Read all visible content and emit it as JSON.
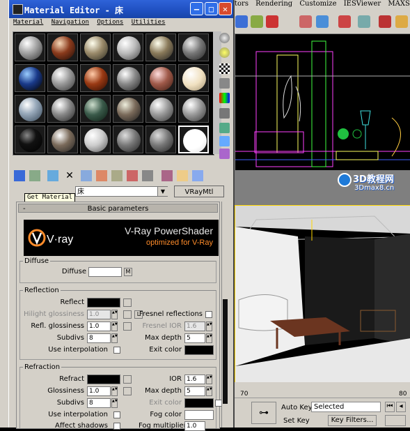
{
  "background_app": {
    "menu_items": [
      "tors",
      "Rendering",
      "Customize",
      "IESViewer",
      "MAXScript"
    ],
    "watermark": {
      "line1": "3D教程网",
      "line2": "3Dmax8.cn"
    },
    "timeline_tick": "70",
    "timeline_tick2": "80",
    "auto_key_label": "Auto Key",
    "set_key_label": "Set Key",
    "selected_value": "Selected",
    "key_filters_label": "Key Filters...",
    "colors": {
      "viewport_bg": "#000000",
      "highlight_border": "#ffd700"
    }
  },
  "material_editor": {
    "title": "Material Editor - 床",
    "menu": [
      "Material",
      "Navigation",
      "Options",
      "Utilities"
    ],
    "tooltip": "Get Material",
    "material_name": "床",
    "material_type": "VRayMtl",
    "rollout_title": "Basic parameters",
    "rollout_collapse": "-",
    "banner": {
      "title": "V-Ray PowerShader",
      "subtitle": "optimized for V-Ray",
      "logo": "V·ray"
    },
    "diffuse": {
      "group": "Diffuse",
      "label": "Diffuse",
      "map_btn": "M",
      "color": "#ffffff"
    },
    "reflection": {
      "group": "Reflection",
      "reflect_label": "Reflect",
      "reflect_color": "#000000",
      "hilight_label": "Hilight glossiness",
      "hilight_value": "1.0",
      "lock_btn": "L",
      "refl_gloss_label": "Refl. glossiness",
      "refl_gloss_value": "1.0",
      "subdivs_label": "Subdivs",
      "subdivs_value": "8",
      "interp_label": "Use interpolation",
      "fresnel_label": "Fresnel reflections",
      "fresnel_lock": "L",
      "fresnel_ior_label": "Fresnel IOR",
      "fresnel_ior_value": "1.6",
      "max_depth_label": "Max depth",
      "max_depth_value": "5",
      "exit_color_label": "Exit color",
      "exit_color": "#000000"
    },
    "refraction": {
      "group": "Refraction",
      "refract_label": "Refract",
      "refract_color": "#000000",
      "gloss_label": "Glossiness",
      "gloss_value": "1.0",
      "subdivs_label": "Subdivs",
      "subdivs_value": "8",
      "interp_label": "Use interpolation",
      "affect_shadows_label": "Affect shadows",
      "ior_label": "IOR",
      "ior_value": "1.6",
      "max_depth_label": "Max depth",
      "max_depth_value": "5",
      "exit_color_label": "Exit color",
      "exit_color": "#000000",
      "fog_color_label": "Fog color",
      "fog_color": "#ffffff",
      "fog_mult_label": "Fog multiplier",
      "fog_mult_value": "1.0"
    }
  }
}
